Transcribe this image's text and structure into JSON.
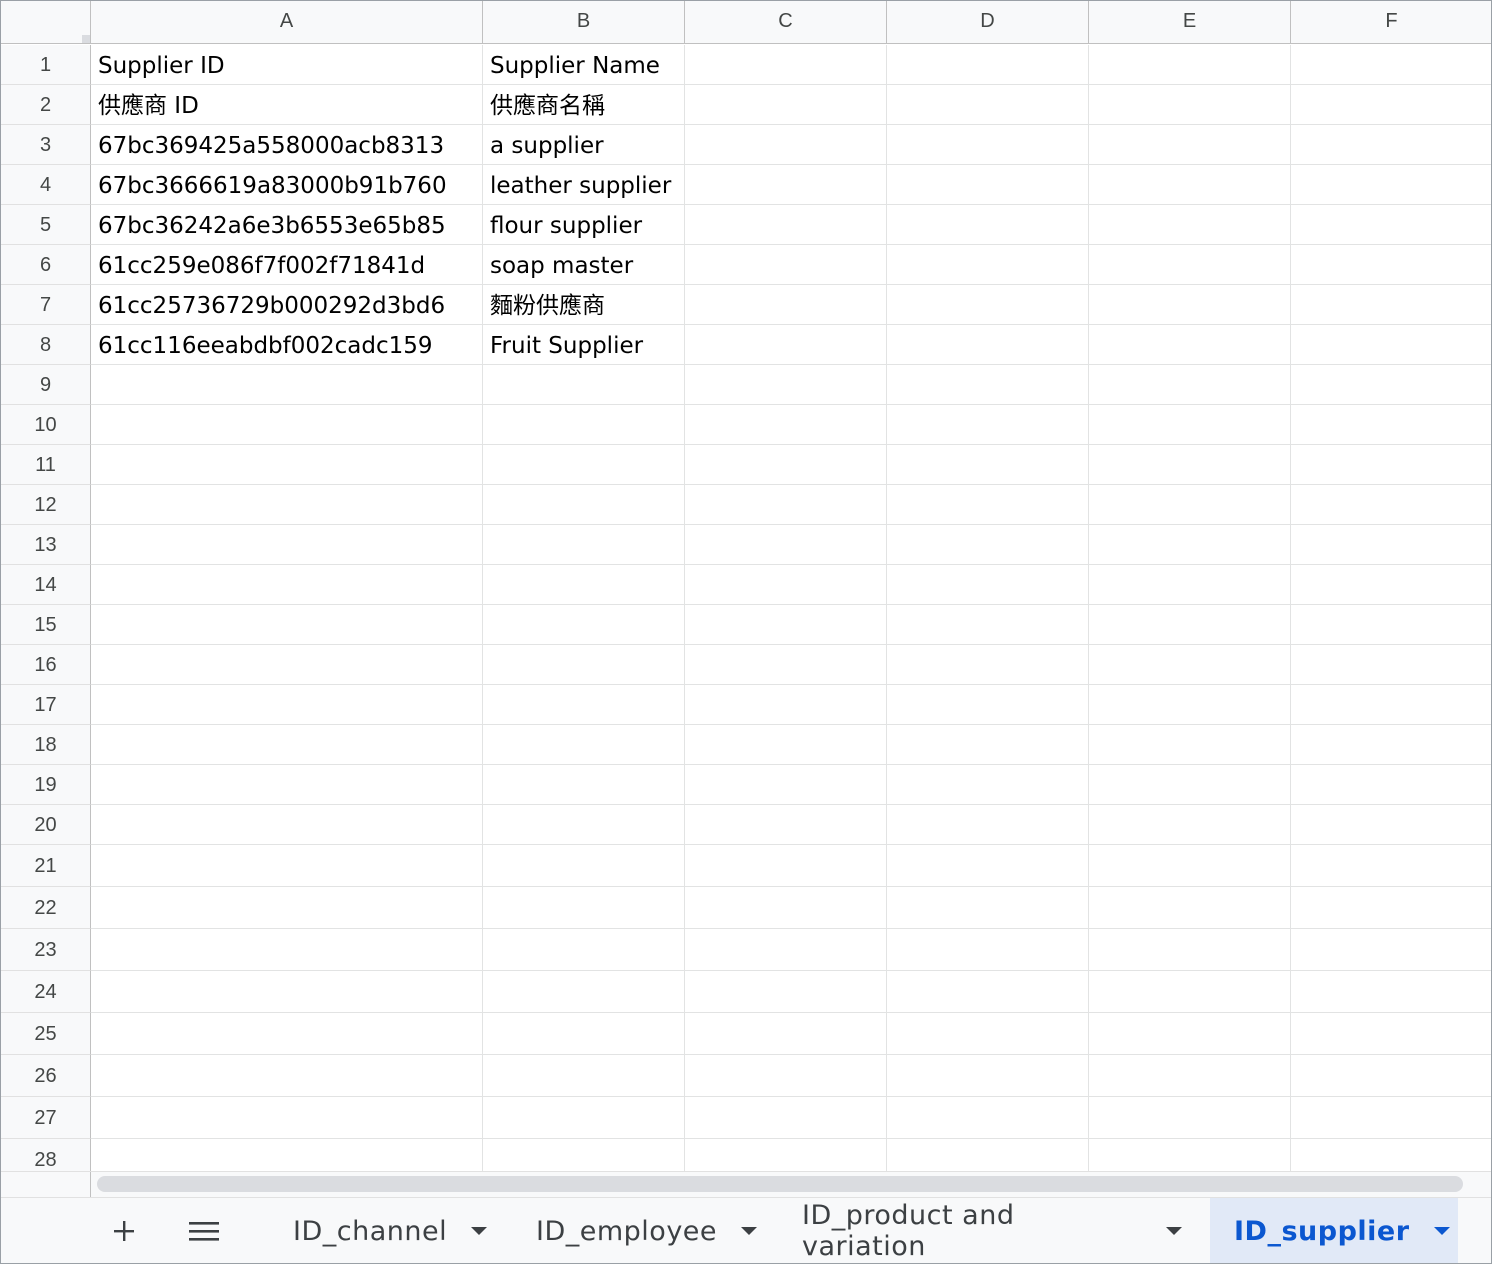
{
  "columns": [
    "A",
    "B",
    "C",
    "D",
    "E",
    "F"
  ],
  "rows": [
    "1",
    "2",
    "3",
    "4",
    "5",
    "6",
    "7",
    "8",
    "9",
    "10",
    "11",
    "12",
    "13",
    "14",
    "15",
    "16",
    "17",
    "18",
    "19",
    "20",
    "21",
    "22",
    "23",
    "24",
    "25",
    "26",
    "27",
    "28"
  ],
  "cells": [
    [
      "Supplier ID",
      "Supplier Name"
    ],
    [
      "供應商 ID",
      "供應商名稱"
    ],
    [
      "67bc369425a558000acb8313",
      "a supplier"
    ],
    [
      "67bc3666619a83000b91b760",
      "leather supplier"
    ],
    [
      "67bc36242a6e3b6553e65b85",
      "flour supplier"
    ],
    [
      "61cc259e086f7f002f71841d",
      "soap master"
    ],
    [
      "61cc25736729b000292d3bd6",
      "麵粉供應商"
    ],
    [
      "61cc116eeabdbf002cadc159",
      "Fruit Supplier"
    ]
  ],
  "tabs": {
    "add_sheet_icon": "plus-icon",
    "all_sheets_icon": "menu-icon",
    "items": [
      {
        "label": "ID_channel",
        "active": false
      },
      {
        "label": "ID_employee",
        "active": false
      },
      {
        "label": "ID_product and variation",
        "active": false
      },
      {
        "label": "ID_supplier",
        "active": true
      }
    ]
  },
  "colors": {
    "header_bg": "#f8f9fa",
    "grid_line": "#e2e3e3",
    "active_tab_bg": "#e1e9f7",
    "active_tab_text": "#0b57d0"
  }
}
